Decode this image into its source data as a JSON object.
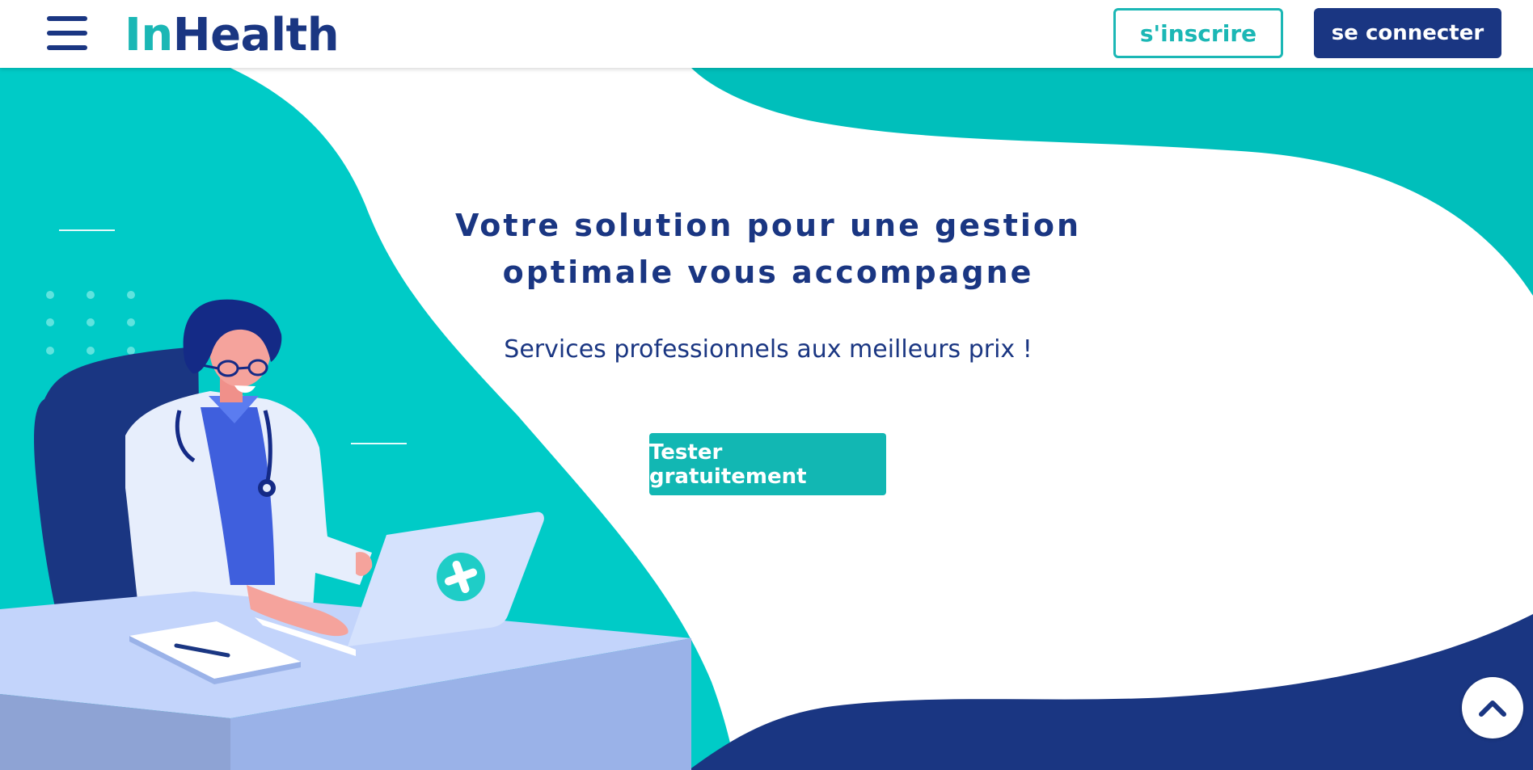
{
  "header": {
    "logo_part1": "In",
    "logo_part2": "Health",
    "signup_label": "s'inscrire",
    "login_label": "se connecter"
  },
  "hero": {
    "title_line1": "Votre solution pour une gestion",
    "title_line2": "optimale vous accompagne",
    "subtitle": "Services professionnels aux meilleurs prix !",
    "cta_label": "Tester gratuitement"
  },
  "icons": {
    "menu": "hamburger-menu-icon",
    "scroll_top": "chevron-up-icon",
    "laptop_badge": "medical-cross-icon"
  },
  "colors": {
    "navy": "#1a3682",
    "teal": "#1bb7b5",
    "bright_teal": "#00cbc7",
    "white": "#ffffff"
  }
}
